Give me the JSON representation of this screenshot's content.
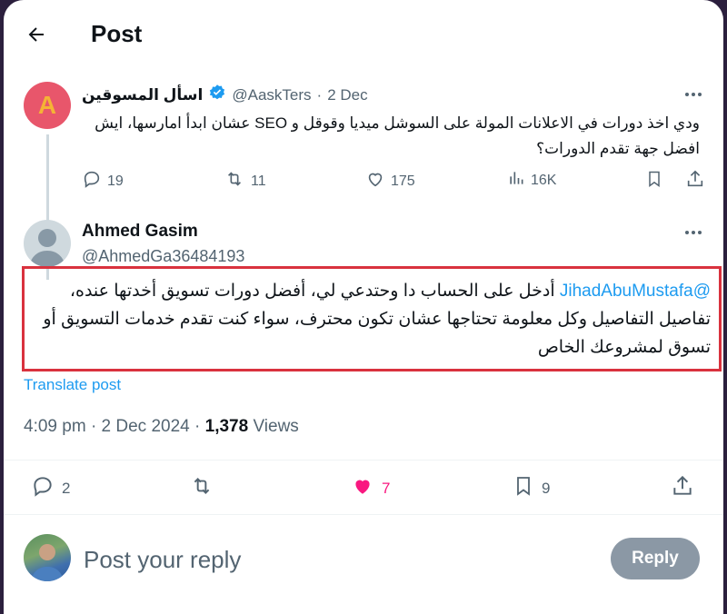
{
  "header": {
    "title": "Post"
  },
  "parent_post": {
    "avatar_letter": "A",
    "display_name": "اسأل المسوقين",
    "handle": "@AaskTers",
    "date": "2 Dec",
    "text": "ودي اخذ دورات في الاعلانات المولة على السوشل ميديا وقوقل و SEO عشان ابدأ امارسها، ايش افضل جهة تقدم الدورات؟",
    "replies": "19",
    "reposts": "11",
    "likes": "175",
    "views": "16K"
  },
  "reply_post": {
    "display_name": "Ahmed Gasim",
    "handle": "@AhmedGa36484193",
    "mention": "@JihadAbuMustafa",
    "text": " أدخل على الحساب دا وحتدعي لي، أفضل دورات تسويق أخدتها عنده، تفاصيل التفاصيل وكل معلومة تحتاجها عشان تكون محترف،  سواء كنت تقدم خدمات التسويق أو تسوق لمشروعك الخاص",
    "translate_label": "Translate post",
    "time": "4:09 pm",
    "date": "2 Dec 2024",
    "view_count": "1,378",
    "views_label": "Views",
    "replies": "2",
    "likes": "7",
    "bookmarks": "9"
  },
  "composer": {
    "placeholder": "Post your reply",
    "reply_label": "Reply"
  },
  "colors": {
    "accent": "#1d9bf0",
    "like": "#f91880",
    "highlight_border": "#d9323e",
    "verified": "#1d9bf0"
  }
}
